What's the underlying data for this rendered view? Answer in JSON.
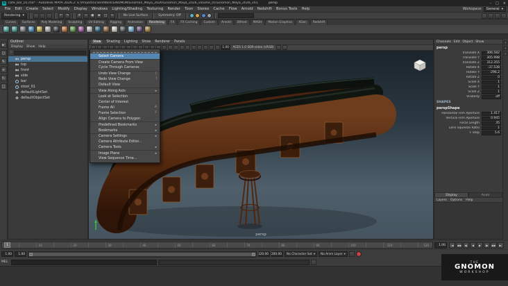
{
  "colors": {
    "selection_blue": "#4a7494",
    "menu_highlight": "#5586b2",
    "maya_teal": "#0fb3ad"
  },
  "window": {
    "title": "cafe_bar_01.ma* - Autodesk MAYA 2026.2: E:\\Projects\\clientWork\\GNOMON\\Gnomon_Maya_2026\\Gnomon_Maya_2026_volume_01\\Gnomon_Maya_2026_v01_Project\\scenes\\cafe_bar_01.ma",
    "view_label": "persp",
    "app_badge": "M",
    "controls": {
      "minimize": "–",
      "maximize": "□",
      "close": "×"
    }
  },
  "menu_bar": {
    "items": [
      {
        "label": "File"
      },
      {
        "label": "Edit"
      },
      {
        "label": "Create"
      },
      {
        "label": "Select"
      },
      {
        "label": "Modify"
      },
      {
        "label": "Display"
      },
      {
        "label": "Windows"
      },
      {
        "label": "Lighting/Shading"
      },
      {
        "label": "Texturing"
      },
      {
        "label": "Render"
      },
      {
        "label": "Toon"
      },
      {
        "label": "Stereo"
      },
      {
        "label": "Cache"
      },
      {
        "label": "Flow"
      },
      {
        "label": "Arnold"
      },
      {
        "label": "Redshift"
      },
      {
        "label": "Bonus Tools"
      },
      {
        "label": "Help"
      }
    ]
  },
  "workspace": {
    "label": "Workspace:",
    "value": "General",
    "caret": "▾"
  },
  "status_line": {
    "menu_set": "Rendering",
    "menu_set_caret": "▾",
    "file_icons": [
      {
        "name": "new-scene-icon"
      },
      {
        "name": "open-scene-icon"
      },
      {
        "name": "save-scene-icon"
      }
    ],
    "history_icons": [
      {
        "name": "undo-icon",
        "glyph": "↶"
      },
      {
        "name": "redo-icon",
        "glyph": "↷"
      }
    ],
    "snap_icons": [
      {
        "name": "snap-grid-icon",
        "glyph": "#"
      },
      {
        "name": "snap-curve-icon",
        "glyph": "~"
      },
      {
        "name": "snap-point-icon",
        "glyph": "●"
      },
      {
        "name": "snap-projected-center-icon",
        "glyph": "◆"
      },
      {
        "name": "snap-view-plane-icon",
        "glyph": "□"
      },
      {
        "name": "make-live-icon",
        "glyph": "+"
      }
    ],
    "live_surface": "No Live Surface",
    "symmetry": "Symmetry: Off",
    "render_icons": [
      {
        "name": "open-render-view-icon",
        "color": "#58b6c0"
      },
      {
        "name": "render-current-frame-icon",
        "color": "#d9a23a"
      },
      {
        "name": "ipr-render-icon",
        "color": "#4f86c6"
      },
      {
        "name": "render-settings-icon",
        "color": "#9aa0a6"
      }
    ],
    "sidebar_icons": [
      {
        "name": "attribute-editor-toggle-icon"
      },
      {
        "name": "tool-settings-toggle-icon"
      },
      {
        "name": "channel-box-toggle-icon"
      },
      {
        "name": "modeling-toolkit-toggle-icon"
      }
    ]
  },
  "shelf": {
    "tabs": [
      {
        "label": "Curves"
      },
      {
        "label": "Surfaces"
      },
      {
        "label": "Poly Modeling"
      },
      {
        "label": "Sculpting"
      },
      {
        "label": "UV Editing"
      },
      {
        "label": "Rigging"
      },
      {
        "label": "Animation"
      },
      {
        "label": "Rendering",
        "active": true
      },
      {
        "label": "FX"
      },
      {
        "label": "FX Caching"
      },
      {
        "label": "Custom"
      },
      {
        "label": "Arnold"
      },
      {
        "label": "Bifrost"
      },
      {
        "label": "MASH"
      },
      {
        "label": "Motion Graphics"
      },
      {
        "label": "XGen"
      },
      {
        "label": "Redshift"
      }
    ],
    "tools": [
      {
        "name": "render-view-shelf-icon",
        "color": "#56b8ae"
      },
      {
        "name": "render-frame-shelf-icon",
        "color": "#4aa8a0"
      },
      {
        "name": "ipr-shelf-icon",
        "color": "#8a9094"
      },
      {
        "name": "render-settings-shelf-icon",
        "color": "#4f9bd5"
      },
      {
        "name": "hypershade-shelf-icon",
        "color": "#d8c24a"
      },
      {
        "name": "checker-material-shelf-icon",
        "color": "#c8c8c8"
      },
      {
        "name": "standard-surface-shelf-icon",
        "color": "#3a3f44"
      },
      {
        "name": "lambert-shelf-icon",
        "color": "#d07b3a"
      },
      {
        "name": "blinn-shelf-icon",
        "color": "#67a84f"
      },
      {
        "name": "phong-shelf-icon",
        "color": "#b05fb0"
      },
      {
        "name": "surface-shader-shelf-icon",
        "color": "#cfd2d4"
      },
      {
        "name": "ocean-shader-shelf-icon",
        "color": "#2f6f8f"
      },
      {
        "name": "displacement-shelf-icon",
        "color": "#9a6b3f"
      },
      {
        "name": "light-shelf-icon",
        "color": "#e8e4d8"
      },
      {
        "name": "shadow-shelf-icon",
        "color": "#505962"
      },
      {
        "name": "sky-shelf-icon",
        "color": "#7fc4e8"
      },
      {
        "name": "aov-shelf-icon",
        "color": "#6b4f8a"
      },
      {
        "name": "texture-shelf-icon",
        "color": "#b0893f"
      }
    ]
  },
  "toolbox": {
    "tools": [
      {
        "name": "select-tool-icon",
        "glyph": "►"
      },
      {
        "name": "lasso-tool-icon",
        "glyph": "○"
      },
      {
        "name": "paint-select-tool-icon",
        "glyph": "✎"
      },
      {
        "name": "move-tool-icon",
        "glyph": "+"
      },
      {
        "name": "rotate-tool-icon",
        "glyph": "↻"
      },
      {
        "name": "scale-tool-icon",
        "glyph": "□"
      }
    ]
  },
  "outliner": {
    "title": "Outliner",
    "menus": [
      {
        "label": "Display"
      },
      {
        "label": "Show"
      },
      {
        "label": "Help"
      }
    ],
    "search_icon": "○",
    "items": [
      {
        "label": "persp",
        "icon": "camera",
        "selected": true
      },
      {
        "label": "top",
        "icon": "camera"
      },
      {
        "label": "front",
        "icon": "camera"
      },
      {
        "label": "side",
        "icon": "camera"
      },
      {
        "label": "bar",
        "icon": "transform"
      },
      {
        "label": "stool_01",
        "icon": "transform"
      },
      {
        "label": "defaultLightSet",
        "icon": "set"
      },
      {
        "label": "defaultObjectSet",
        "icon": "set"
      }
    ]
  },
  "panel_menu": {
    "items": [
      {
        "label": "View",
        "open": true
      },
      {
        "label": "Shading"
      },
      {
        "label": "Lighting"
      },
      {
        "label": "Show"
      },
      {
        "label": "Renderer"
      },
      {
        "label": "Panels"
      }
    ]
  },
  "view_menu": {
    "items": [
      {
        "label": "Select Camera",
        "highlighted": true
      },
      {
        "label": "Create Camera From View",
        "sep": true
      },
      {
        "label": "Cycle Through Cameras"
      },
      {
        "label": "Undo View Change",
        "shortcut": "[",
        "sep": true
      },
      {
        "label": "Redo View Change",
        "shortcut": "]"
      },
      {
        "label": "Default View"
      },
      {
        "label": "View Along Axis",
        "submenu": true,
        "sep": true
      },
      {
        "label": "Look at Selection",
        "sep": true
      },
      {
        "label": "Center of Interest"
      },
      {
        "label": "Frame All",
        "shortcut": "A"
      },
      {
        "label": "Frame Selection",
        "shortcut": "F"
      },
      {
        "label": "Align Camera to Polygon"
      },
      {
        "label": "Predefined Bookmarks",
        "submenu": true,
        "sep": true
      },
      {
        "label": "Bookmarks",
        "submenu": true
      },
      {
        "label": "Camera Settings",
        "submenu": true,
        "sep": true
      },
      {
        "label": "Camera Attribute Editor..."
      },
      {
        "label": "Camera Tools",
        "submenu": true
      },
      {
        "label": "Image Plane",
        "submenu": true,
        "sep": true
      },
      {
        "label": "View Sequence Time..."
      }
    ]
  },
  "viewport": {
    "camera_label": "persp",
    "exposure": "1.00",
    "color_space": "ACES 1.0 SDR-video (sRGB)",
    "toolbar_icons": [
      {
        "name": "select-camera-icon"
      },
      {
        "name": "lock-camera-icon"
      },
      {
        "name": "camera-attributes-icon"
      },
      {
        "name": "bookmark-icon"
      },
      {
        "name": "image-plane-icon"
      },
      {
        "name": "grid-toggle-icon"
      },
      {
        "name": "film-gate-icon"
      },
      {
        "name": "resolution-gate-icon"
      },
      {
        "name": "gate-mask-icon"
      },
      {
        "name": "field-chart-icon"
      },
      {
        "name": "safe-action-icon"
      },
      {
        "name": "safe-title-icon"
      },
      {
        "name": "wireframe-icon"
      },
      {
        "name": "smooth-shade-icon"
      },
      {
        "name": "textured-icon"
      },
      {
        "name": "use-lights-icon"
      },
      {
        "name": "shadows-icon"
      },
      {
        "name": "ambient-occlusion-icon"
      },
      {
        "name": "motion-blur-icon"
      },
      {
        "name": "anti-aliasing-icon"
      },
      {
        "name": "isolate-select-icon"
      },
      {
        "name": "xray-icon"
      }
    ]
  },
  "channel_box": {
    "tabs": [
      {
        "label": "Channels"
      },
      {
        "label": "Edit"
      },
      {
        "label": "Object"
      },
      {
        "label": "Show"
      }
    ],
    "node": "persp",
    "attributes": [
      {
        "name": "Translate X",
        "value": "306.582"
      },
      {
        "name": "Translate Y",
        "value": "305.998"
      },
      {
        "name": "Translate Z",
        "value": "312.355"
      },
      {
        "name": "Rotate X",
        "value": "-37.538"
      },
      {
        "name": "Rotate Y",
        "value": "-296.2"
      },
      {
        "name": "Rotate Z",
        "value": "0"
      },
      {
        "name": "Scale X",
        "value": "1"
      },
      {
        "name": "Scale Y",
        "value": "1"
      },
      {
        "name": "Scale Z",
        "value": "1"
      },
      {
        "name": "Visibility",
        "value": "off"
      }
    ],
    "shapes_label": "SHAPES",
    "shape_node": "perspShape",
    "shape_attributes": [
      {
        "name": "Horizontal Film Aperture",
        "value": "1.417"
      },
      {
        "name": "Vertical Film Aperture",
        "value": "0.945"
      },
      {
        "name": "Focal Length",
        "value": "35"
      },
      {
        "name": "Lens Squeeze Ratio",
        "value": "1"
      },
      {
        "name": "F Stop",
        "value": "5.6"
      }
    ],
    "bottom_tabs": {
      "display": "Display",
      "anim": "Anim"
    },
    "layer_menus": [
      {
        "label": "Layers"
      },
      {
        "label": "Options"
      },
      {
        "label": "Help"
      }
    ]
  },
  "time_slider": {
    "ticks": [
      {
        "t": "1"
      },
      {
        "t": "10"
      },
      {
        "t": "20"
      },
      {
        "t": "30"
      },
      {
        "t": "40"
      },
      {
        "t": "50"
      },
      {
        "t": "60"
      },
      {
        "t": "70"
      },
      {
        "t": "80"
      },
      {
        "t": "90"
      },
      {
        "t": "100"
      },
      {
        "t": "110"
      },
      {
        "t": "120"
      }
    ],
    "current_frame_marker": "1",
    "current_frame_field": "1.00",
    "playback": [
      {
        "name": "go-to-start-button",
        "glyph": "|◀"
      },
      {
        "name": "step-back-frame-button",
        "glyph": "◀◀"
      },
      {
        "name": "step-back-key-button",
        "glyph": "◀|"
      },
      {
        "name": "play-backwards-button",
        "glyph": "◀"
      },
      {
        "name": "play-forwards-button",
        "glyph": "▶"
      },
      {
        "name": "step-forward-key-button",
        "glyph": "|▶"
      },
      {
        "name": "step-forward-frame-button",
        "glyph": "▶▶"
      },
      {
        "name": "go-to-end-button",
        "glyph": "▶|"
      }
    ]
  },
  "range_slider": {
    "anim_start": "1.00",
    "play_start": "1.00",
    "play_end": "120.00",
    "anim_end": "200.00",
    "character_set": "No Character Set",
    "anim_layer": "No Anim Layer",
    "caret": "▾"
  },
  "command_line": {
    "label": "MEL"
  },
  "logo": {
    "line1": "THE",
    "line2": "GNOMON",
    "line3": "WORKSHOP"
  }
}
